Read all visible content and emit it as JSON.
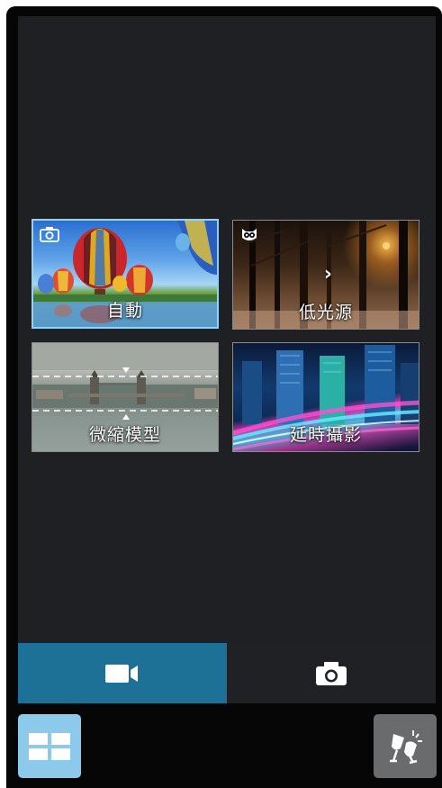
{
  "modes": [
    {
      "id": "auto",
      "label": "自動",
      "icon": "camera-icon",
      "selected": true
    },
    {
      "id": "low_light",
      "label": "低光源",
      "icon": "owl-icon",
      "selected": false
    },
    {
      "id": "miniature",
      "label": "微縮模型",
      "icon": "",
      "selected": false
    },
    {
      "id": "time_lapse",
      "label": "延時攝影",
      "icon": "",
      "selected": false
    }
  ],
  "tabs": [
    {
      "id": "video",
      "icon": "video-camera-icon",
      "active": true
    },
    {
      "id": "photo",
      "icon": "camera-icon",
      "active": false
    }
  ],
  "bottom_buttons": {
    "left": {
      "icon": "grid-icon"
    },
    "right": {
      "icon": "effects-icon"
    }
  },
  "colors": {
    "accent": "#1e7196",
    "selected_border": "#8fd3f7",
    "grid_button": "#8dc9ea",
    "fx_button": "#6a6b6c",
    "panel": "#1f2023"
  }
}
